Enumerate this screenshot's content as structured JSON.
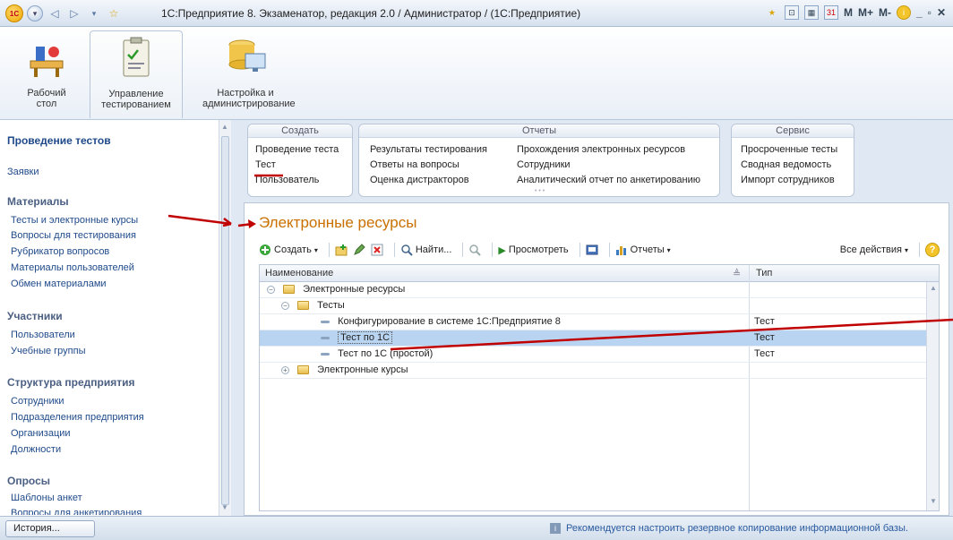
{
  "window": {
    "title": "1С:Предприятие 8. Экзаменатор, редакция 2.0 / Администратор /  (1С:Предприятие)",
    "logo_text": "1С",
    "right_buttons": [
      "M",
      "M+",
      "M-"
    ]
  },
  "sections": [
    {
      "label": "Рабочий стол"
    },
    {
      "label": "Управление тестированием"
    },
    {
      "label": "Настройка и администрирование"
    }
  ],
  "sidebar": {
    "top_links": [
      "Проведение тестов",
      "Заявки"
    ],
    "groups": [
      {
        "title": "Материалы",
        "items": [
          "Тесты и электронные курсы",
          "Вопросы для тестирования",
          "Рубрикатор вопросов",
          "Материалы пользователей",
          "Обмен материалами"
        ]
      },
      {
        "title": "Участники",
        "items": [
          "Пользователи",
          "Учебные группы"
        ]
      },
      {
        "title": "Структура предприятия",
        "items": [
          "Сотрудники",
          "Подразделения предприятия",
          "Организации",
          "Должности"
        ]
      },
      {
        "title": "Опросы",
        "items": [
          "Шаблоны анкет",
          "Вопросы для анкетирования"
        ]
      }
    ]
  },
  "command_panel": {
    "create": {
      "title": "Создать",
      "items": [
        "Проведение теста",
        "Тест",
        "Пользователь"
      ]
    },
    "reports": {
      "title": "Отчеты",
      "col1": [
        "Результаты тестирования",
        "Ответы на вопросы",
        "Оценка дистракторов"
      ],
      "col2": [
        "Прохождения электронных ресурсов",
        "Сотрудники",
        "Аналитический отчет по анкетированию"
      ]
    },
    "service": {
      "title": "Сервис",
      "items": [
        "Просроченные тесты",
        "Сводная ведомость",
        "Импорт сотрудников"
      ]
    }
  },
  "form": {
    "title": "Электронные ресурсы",
    "toolbar": {
      "create": "Создать",
      "find": "Найти...",
      "view": "Просмотреть",
      "reports": "Отчеты",
      "all_actions": "Все действия"
    },
    "columns": [
      "Наименование",
      "Тип"
    ],
    "rows": [
      {
        "name": "Электронные ресурсы",
        "type": ""
      },
      {
        "name": "Тесты",
        "type": ""
      },
      {
        "name": "Конфигурирование в системе 1С:Предприятие 8",
        "type": "Тест"
      },
      {
        "name": "Тест по 1С",
        "type": "Тест"
      },
      {
        "name": "Тест по 1С (простой)",
        "type": "Тест"
      },
      {
        "name": "Электронные курсы",
        "type": ""
      }
    ],
    "selected_row": "Тест по 1С"
  },
  "statusbar": {
    "history": "История...",
    "message": "Рекомендуется настроить резервное копирование информационной базы."
  },
  "colors": {
    "accent_title": "#c97000",
    "link": "#1f4a8a",
    "selection": "#b9d4f1",
    "annotation": "#c00000"
  }
}
